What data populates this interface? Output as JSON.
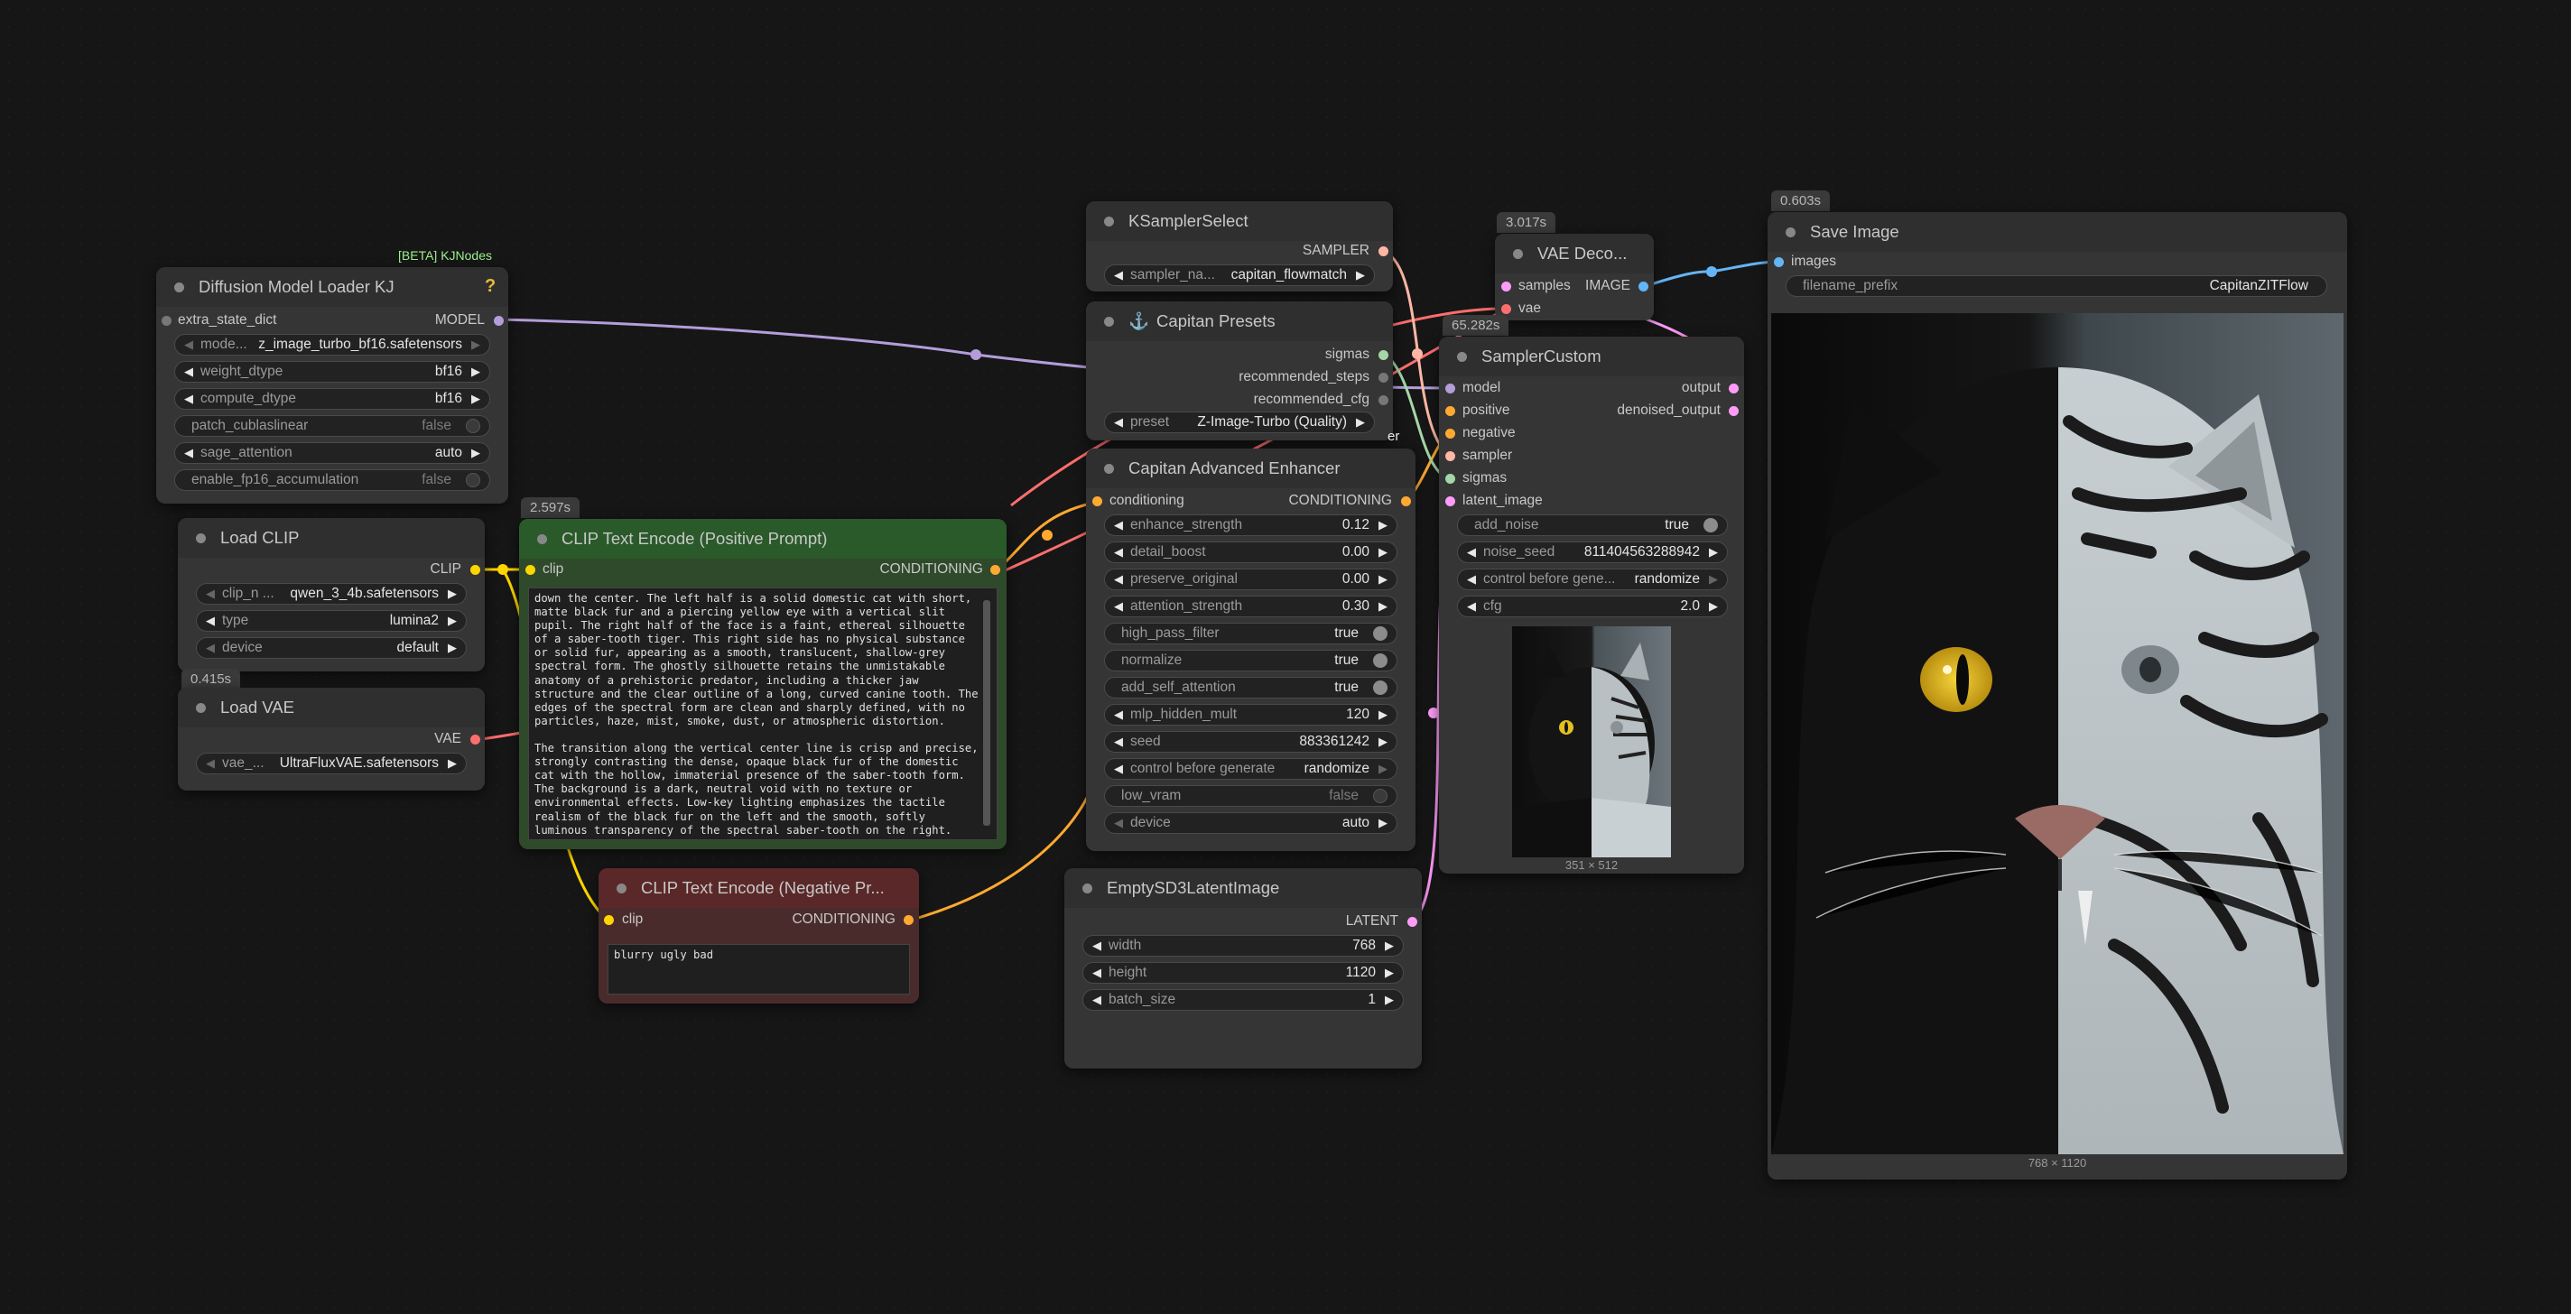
{
  "nodes": {
    "diffusion_loader": {
      "header_label": "[BETA] KJNodes",
      "title": "Diffusion Model Loader KJ",
      "help": "?",
      "input_extra": "extra_state_dict",
      "output_model": "MODEL",
      "widgets": [
        {
          "label": "mode...",
          "value": "z_image_turbo_bf16.safetensors"
        },
        {
          "label": "weight_dtype",
          "value": "bf16"
        },
        {
          "label": "compute_dtype",
          "value": "bf16"
        },
        {
          "label": "patch_cublaslinear",
          "value": "false"
        },
        {
          "label": "sage_attention",
          "value": "auto"
        },
        {
          "label": "enable_fp16_accumulation",
          "value": "false"
        }
      ]
    },
    "load_clip": {
      "title": "Load CLIP",
      "output": "CLIP",
      "widgets": [
        {
          "label": "clip_n ...",
          "value": "qwen_3_4b.safetensors"
        },
        {
          "label": "type",
          "value": "lumina2"
        },
        {
          "label": "device",
          "value": "default"
        }
      ]
    },
    "load_vae": {
      "badge": "0.415s",
      "title": "Load VAE",
      "output": "VAE",
      "widgets": [
        {
          "label": "vae_...",
          "value": "UltraFluxVAE.safetensors"
        }
      ]
    },
    "clip_pos": {
      "badge": "2.597s",
      "title": "CLIP Text Encode (Positive Prompt)",
      "input": "clip",
      "output": "CONDITIONING",
      "text": "down the center. The left half is a solid domestic cat with short, matte black fur and a piercing yellow eye with a vertical slit pupil. The right half of the face is a faint, ethereal silhouette of a saber-tooth tiger. This right side has no physical substance or solid fur, appearing as a smooth, translucent, shallow-grey spectral form. The ghostly silhouette retains the unmistakable anatomy of a prehistoric predator, including a thicker jaw structure and the clear outline of a long, curved canine tooth. The edges of the spectral form are clean and sharply defined, with no particles, haze, mist, smoke, dust, or atmospheric distortion.\n\nThe transition along the vertical center line is crisp and precise, strongly contrasting the dense, opaque black fur of the domestic cat with the hollow, immaterial presence of the saber-tooth form. The background is a dark, neutral void with no texture or environmental effects. Low-key lighting emphasizes the tactile realism of the black fur on the left and the smooth, softly luminous transparency of the spectral saber-tooth on the right."
    },
    "clip_neg": {
      "title": "CLIP Text Encode (Negative Pr...",
      "input": "clip",
      "output": "CONDITIONING",
      "text": "blurry ugly bad"
    },
    "ksampler_select": {
      "title": "KSamplerSelect",
      "output": "SAMPLER",
      "widgets": [
        {
          "label": "sampler_na...",
          "value": "capitan_flowmatch"
        }
      ]
    },
    "capitan_presets": {
      "icon": "⚓",
      "title": "Capitan Presets",
      "outputs": [
        "sigmas",
        "recommended_steps",
        "recommended_cfg"
      ],
      "widgets": [
        {
          "label": "preset",
          "value": "Z-Image-Turbo (Quality)"
        }
      ]
    },
    "capitan_enhancer": {
      "title": "Capitan Advanced Enhancer",
      "input": "conditioning",
      "output": "CONDITIONING",
      "widgets": [
        {
          "label": "enhance_strength",
          "value": "0.12"
        },
        {
          "label": "detail_boost",
          "value": "0.00"
        },
        {
          "label": "preserve_original",
          "value": "0.00"
        },
        {
          "label": "attention_strength",
          "value": "0.30"
        },
        {
          "label": "high_pass_filter",
          "value": "true"
        },
        {
          "label": "normalize",
          "value": "true"
        },
        {
          "label": "add_self_attention",
          "value": "true"
        },
        {
          "label": "mlp_hidden_mult",
          "value": "120"
        },
        {
          "label": "seed",
          "value": "883361242"
        },
        {
          "label": "control before generate",
          "value": "randomize"
        },
        {
          "label": "low_vram",
          "value": "false"
        },
        {
          "label": "device",
          "value": "auto"
        }
      ]
    },
    "empty_latent": {
      "title": "EmptySD3LatentImage",
      "output": "LATENT",
      "widgets": [
        {
          "label": "width",
          "value": "768"
        },
        {
          "label": "height",
          "value": "1120"
        },
        {
          "label": "batch_size",
          "value": "1"
        }
      ]
    },
    "vae_decode": {
      "badge": "3.017s",
      "title": "VAE Deco...",
      "inputs": [
        "samples",
        "vae"
      ],
      "output": "IMAGE"
    },
    "sampler_custom": {
      "badge": "65.282s",
      "title": "SamplerCustom",
      "inputs": [
        "model",
        "positive",
        "negative",
        "sampler",
        "sigmas",
        "latent_image"
      ],
      "outputs": [
        "output",
        "denoised_output"
      ],
      "widgets": [
        {
          "label": "add_noise",
          "value": "true"
        },
        {
          "label": "noise_seed",
          "value": "811404563288942"
        },
        {
          "label": "control before gene...",
          "value": "randomize"
        },
        {
          "label": "cfg",
          "value": "2.0"
        }
      ],
      "preview_caption": "351 × 512"
    },
    "save_image": {
      "badge": "0.603s",
      "title": "Save Image",
      "input": "images",
      "widgets": [
        {
          "label": "filename_prefix",
          "value": "CapitanZITFlow"
        }
      ],
      "image_caption": "768 × 1120"
    }
  },
  "wire_label_fragment": "er",
  "colors": {
    "model": "#b39ddb",
    "clip": "#ffd500",
    "vae": "#ff6e6e",
    "conditioning": "#ffa931",
    "latent": "#ff9cf9",
    "image": "#64b5f6",
    "sampler": "#ffb7a5",
    "sigmas": "#a5d6a7",
    "pos_node_bg": "#2f4a2a",
    "pos_title_bg": "#2a5a2a",
    "neg_node_bg": "#4a2b2b",
    "neg_title_bg": "#5a2828"
  }
}
